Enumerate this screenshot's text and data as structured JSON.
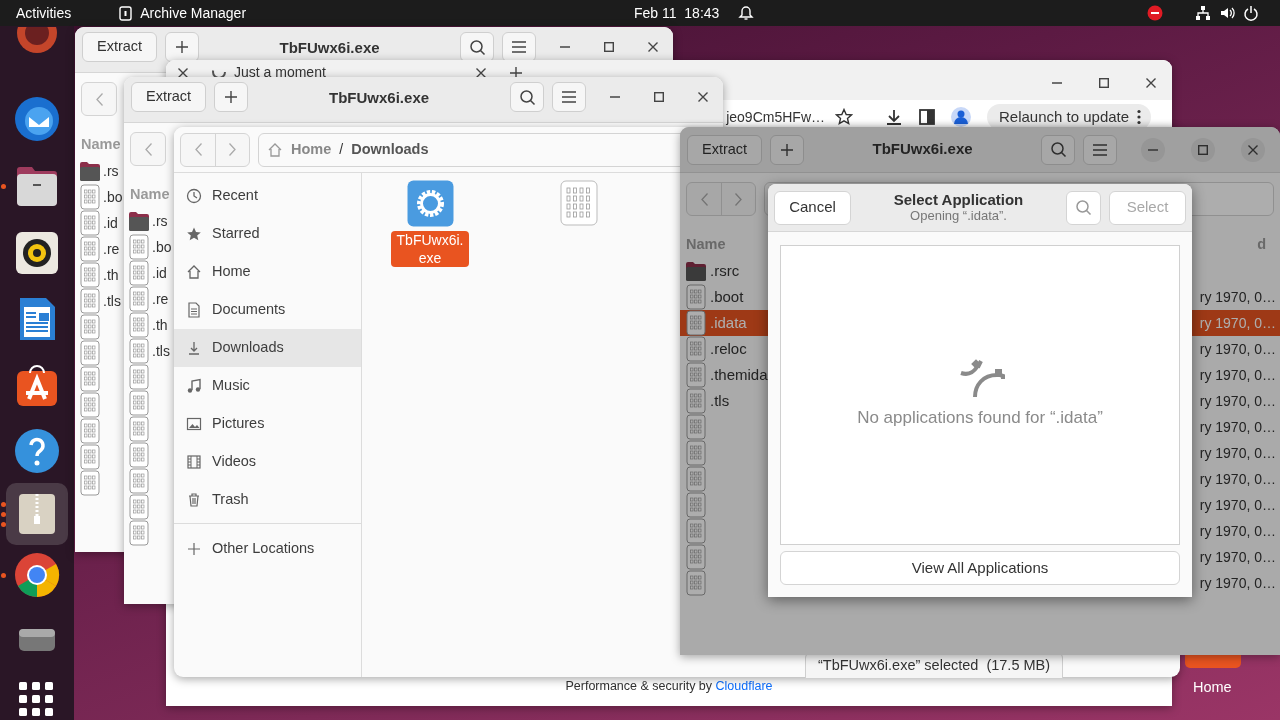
{
  "top_bar": {
    "activities": "Activities",
    "app_name": "Archive Manager",
    "clock": "Feb 11  18:43"
  },
  "dock": [
    {
      "kind": "circle",
      "running": false,
      "selected": false
    },
    {
      "kind": "bird",
      "running": false,
      "selected": false
    },
    {
      "kind": "drawer",
      "running": true,
      "selected": false
    },
    {
      "kind": "speaker",
      "running": false,
      "selected": false
    },
    {
      "kind": "document",
      "running": false,
      "selected": false
    },
    {
      "kind": "bag",
      "running": false,
      "selected": false
    },
    {
      "kind": "help",
      "running": false,
      "selected": false
    },
    {
      "kind": "zipper",
      "running": true,
      "selected": true
    },
    {
      "kind": "wheel",
      "running": true,
      "selected": false
    },
    {
      "kind": "drive",
      "running": false,
      "selected": false
    },
    {
      "kind": "grid",
      "running": false,
      "selected": false
    }
  ],
  "desktop_icon": {
    "label": "Home"
  },
  "archive_back": {
    "title": "TbFUwx6i.exe",
    "extract": "Extract",
    "dimmed": false,
    "columns": [
      "Name"
    ],
    "rows": [
      {
        "kind": "folder",
        "name": ".rs"
      },
      {
        "kind": "binary",
        "name": ".bo"
      },
      {
        "kind": "binary",
        "name": ".id"
      },
      {
        "kind": "binary",
        "name": ".re"
      },
      {
        "kind": "binary",
        "name": ".th"
      },
      {
        "kind": "binary",
        "name": ".tls"
      },
      {
        "kind": "binary"
      },
      {
        "kind": "binary"
      },
      {
        "kind": "binary"
      },
      {
        "kind": "binary"
      },
      {
        "kind": "binary"
      },
      {
        "kind": "binary"
      },
      {
        "kind": "binary"
      }
    ]
  },
  "browser": {
    "tab": "Just a moment",
    "address": "jeo9Cm5HFw…",
    "relaunch": "Relaunch to update",
    "footer": "Performance & security by ",
    "footer_link": "Cloudflare"
  },
  "archive_middle": {
    "title": "TbFUwx6i.exe",
    "extract": "Extract",
    "dimmed": false,
    "columns": [
      "Name"
    ],
    "rows": [
      {
        "kind": "folder",
        "name": ".rs"
      },
      {
        "kind": "binary",
        "name": ".bo"
      },
      {
        "kind": "binary",
        "name": ".id"
      },
      {
        "kind": "binary",
        "name": ".re"
      },
      {
        "kind": "binary",
        "name": ".th"
      },
      {
        "kind": "binary",
        "name": ".tls"
      },
      {
        "kind": "binary"
      },
      {
        "kind": "binary"
      },
      {
        "kind": "binary"
      },
      {
        "kind": "binary"
      },
      {
        "kind": "binary"
      },
      {
        "kind": "binary"
      },
      {
        "kind": "binary"
      }
    ]
  },
  "file_chooser": {
    "path": [
      {
        "label": "Home",
        "kind": "home"
      },
      {
        "label": "Downloads",
        "kind": "folder"
      }
    ],
    "path_separator": "/",
    "sidebar": [
      {
        "label": "Recent",
        "kind": "recent",
        "selected": false
      },
      {
        "label": "Starred",
        "kind": "star",
        "selected": false
      },
      {
        "label": "Home",
        "kind": "home",
        "selected": false
      },
      {
        "label": "Documents",
        "kind": "document",
        "selected": false
      },
      {
        "label": "Downloads",
        "kind": "download",
        "selected": true
      },
      {
        "label": "Music",
        "kind": "music",
        "selected": false
      },
      {
        "label": "Pictures",
        "kind": "picture",
        "selected": false
      },
      {
        "label": "Videos",
        "kind": "video",
        "selected": false
      },
      {
        "label": "Trash",
        "kind": "trash",
        "selected": false
      },
      {
        "label": "Other Locations",
        "kind": "plus",
        "selected": false
      }
    ],
    "files": [
      {
        "kind": "executable",
        "label": "TbFUwx6i.\nexe",
        "selected": true
      },
      {
        "kind": "binary",
        "selected": false
      }
    ],
    "status": "“TbFUwx6i.exe” selected  (17.5 MB)"
  },
  "archive_front": {
    "title": "TbFUwx6i.exe",
    "extract": "Extract",
    "dimmed": true,
    "columns": [
      "Name",
      "d"
    ],
    "rows": [
      {
        "kind": "folder",
        "name": ".rsrc",
        "selected": false
      },
      {
        "kind": "binary",
        "name": ".boot",
        "modified": "ry 1970, 0…",
        "selected": false
      },
      {
        "kind": "binary",
        "name": ".idata",
        "modified": "ry 1970, 0…",
        "selected": true
      },
      {
        "kind": "binary",
        "name": ".reloc",
        "modified": "ry 1970, 0…",
        "selected": false
      },
      {
        "kind": "binary",
        "name": ".themida",
        "modified": "ry 1970, 0…",
        "selected": false
      },
      {
        "kind": "binary",
        "name": ".tls",
        "modified": "ry 1970, 0…",
        "selected": false
      },
      {
        "kind": "binary",
        "modified": "ry 1970, 0…",
        "selected": false
      },
      {
        "kind": "binary",
        "modified": "ry 1970, 0…",
        "selected": false
      },
      {
        "kind": "binary",
        "modified": "ry 1970, 0…",
        "selected": false
      },
      {
        "kind": "binary",
        "modified": "ry 1970, 0…",
        "selected": false
      },
      {
        "kind": "binary",
        "modified": "ry 1970, 0…",
        "selected": false
      },
      {
        "kind": "binary",
        "modified": "ry 1970, 0…",
        "selected": false
      },
      {
        "kind": "binary",
        "modified": "ry 1970, 0…",
        "selected": false
      }
    ]
  },
  "dialog": {
    "cancel": "Cancel",
    "title": "Select Application",
    "subtitle": "Opening “.idata”.",
    "select": "Select",
    "select_disabled": true,
    "empty_message": "No applications found for “.idata”",
    "view_all": "View All Applications"
  }
}
